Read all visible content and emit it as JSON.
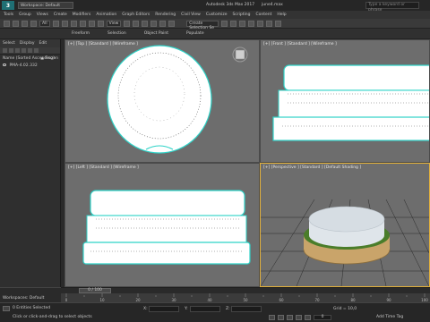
{
  "titlebar": {
    "logo": "3",
    "workspace": "Workspace: Default",
    "app_title": "Autodesk 3ds Max 2017",
    "file_name": "june4.max",
    "search_placeholder": "Type a keyword or phrase"
  },
  "menu": [
    "Tools",
    "Group",
    "Views",
    "Create",
    "Modifiers",
    "Animation",
    "Graph Editors",
    "Rendering",
    "Civil View",
    "Customize",
    "Scripting",
    "Content",
    "Help"
  ],
  "toolbar": {
    "filter": "All",
    "view": "View",
    "selection_set": "Create Selection Se"
  },
  "ribbon": [
    "Freeform",
    "Selection",
    "Object Paint",
    "Populate"
  ],
  "explorer": {
    "tabs": [
      "Select",
      "Display",
      "Edit"
    ],
    "rows": [
      {
        "label": "Name (Sorted Ascending)",
        "right": "▲ Frozen"
      },
      {
        "label": "PMA-4.02.332",
        "right": ""
      }
    ]
  },
  "viewports": {
    "top": "[+] [Top ] [Standard ] [Wireframe ]",
    "front": "[+] [Front ] [Standard ] [Wireframe ]",
    "left": "[+] [Left ] [Standard ] [Wireframe ]",
    "perspective": "[+] [Perspective ] [Standard ] [Default Shading ]"
  },
  "timeline": {
    "slider": "0 / 100",
    "ticks": [
      "0",
      "10",
      "20",
      "30",
      "40",
      "50",
      "60",
      "70",
      "80",
      "90",
      "100"
    ]
  },
  "workspace_bar": "Workspaces: Default",
  "status": {
    "selected": "0 Entities Selected",
    "prompt": "Click or click-and-drag to select objects",
    "x_label": "X:",
    "y_label": "Y:",
    "z_label": "Z:",
    "grid": "Grid = 10,0",
    "frame": "0",
    "time_tag": "Add Time Tag"
  },
  "colors": {
    "viewport_bg": "#6d6d6d",
    "wire_highlight": "#2fd3c8",
    "active_border": "#e2b13c",
    "object_cap": "#d6dde3",
    "object_band": "#4a7d2a",
    "object_base": "#c9a46a"
  }
}
